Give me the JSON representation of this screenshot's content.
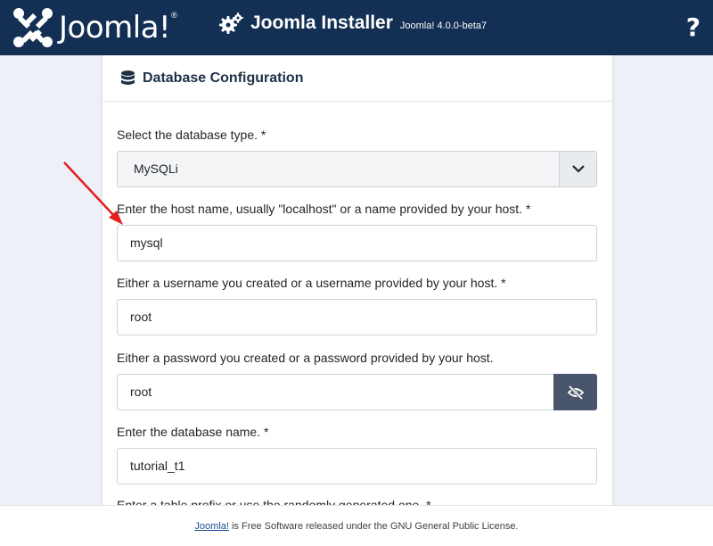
{
  "header": {
    "logo_text": "Joomla!",
    "logo_mark": "®",
    "title": "Joomla Installer",
    "version": "Joomla! 4.0.0-beta7",
    "help_symbol": "?"
  },
  "card": {
    "title": "Database Configuration",
    "fields": {
      "db_type": {
        "label": "Select the database type. *",
        "value": "MySQLi"
      },
      "host": {
        "label": "Enter the host name, usually \"localhost\" or a name provided by your host. *",
        "value": "mysql"
      },
      "username": {
        "label": "Either a username you created or a username provided by your host. *",
        "value": "root"
      },
      "password": {
        "label": "Either a password you created or a password provided by your host.",
        "value": "root"
      },
      "db_name": {
        "label": "Enter the database name. *",
        "value": "tutorial_t1"
      },
      "prefix": {
        "label": "Enter a table prefix or use the randomly generated one. *"
      }
    }
  },
  "footer": {
    "link_text": "Joomla!",
    "text": " is Free Software released under the GNU General Public License."
  },
  "colors": {
    "header_bg": "#132f53",
    "page_bg": "#edf0f7",
    "toggle_bg": "#49556a",
    "arrow": "#e41f1f"
  },
  "icons": [
    "joomla-logo-icon",
    "gears-icon",
    "help-icon",
    "database-icon",
    "chevron-down-icon",
    "eye-slash-icon"
  ]
}
